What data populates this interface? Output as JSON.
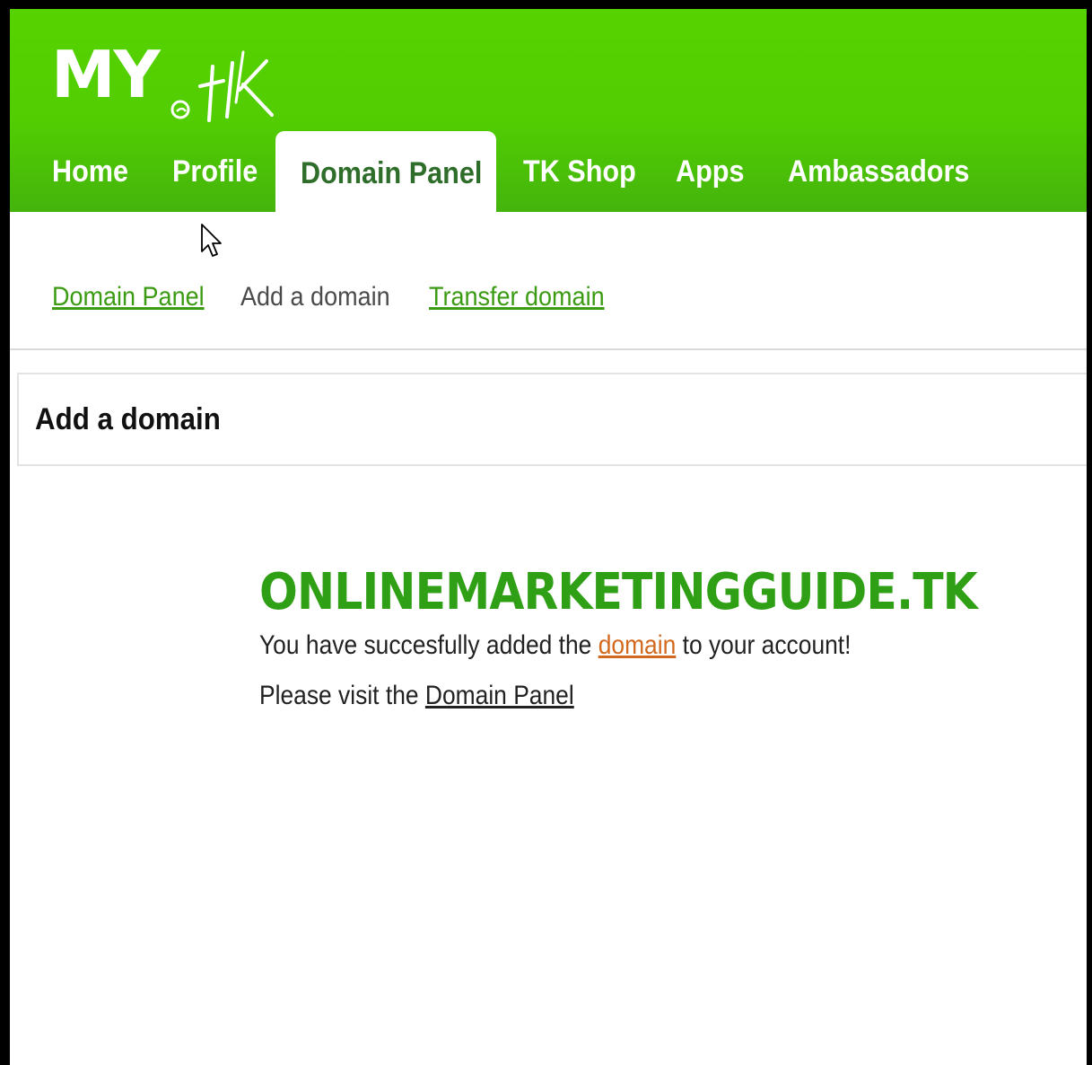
{
  "logo": {
    "text_my": "MY",
    "text_tk": ".tk"
  },
  "nav": {
    "items": [
      {
        "label": "Home"
      },
      {
        "label": "Profile"
      },
      {
        "label": "Domain Panel",
        "active": true
      },
      {
        "label": "TK Shop"
      },
      {
        "label": "Apps"
      },
      {
        "label": "Ambassadors"
      }
    ]
  },
  "subnav": {
    "items": [
      {
        "label": "Domain Panel",
        "link": true
      },
      {
        "label": "Add a domain",
        "current": true
      },
      {
        "label": "Transfer domain",
        "link": true
      }
    ]
  },
  "panel": {
    "title": "Add a domain"
  },
  "content": {
    "domain_name": "ONLINEMARKETINGGUIDE.TK",
    "success_prefix": "You have succesfully added the ",
    "success_link": "domain",
    "success_suffix": " to your account!",
    "visit_prefix": "Please visit the ",
    "visit_link": "Domain Panel"
  },
  "colors": {
    "header_green": "#52cd02",
    "link_green": "#3b9b12",
    "domain_green": "#2fa015",
    "active_tab_text": "#2f6d2a",
    "orange_link": "#d2691e"
  }
}
